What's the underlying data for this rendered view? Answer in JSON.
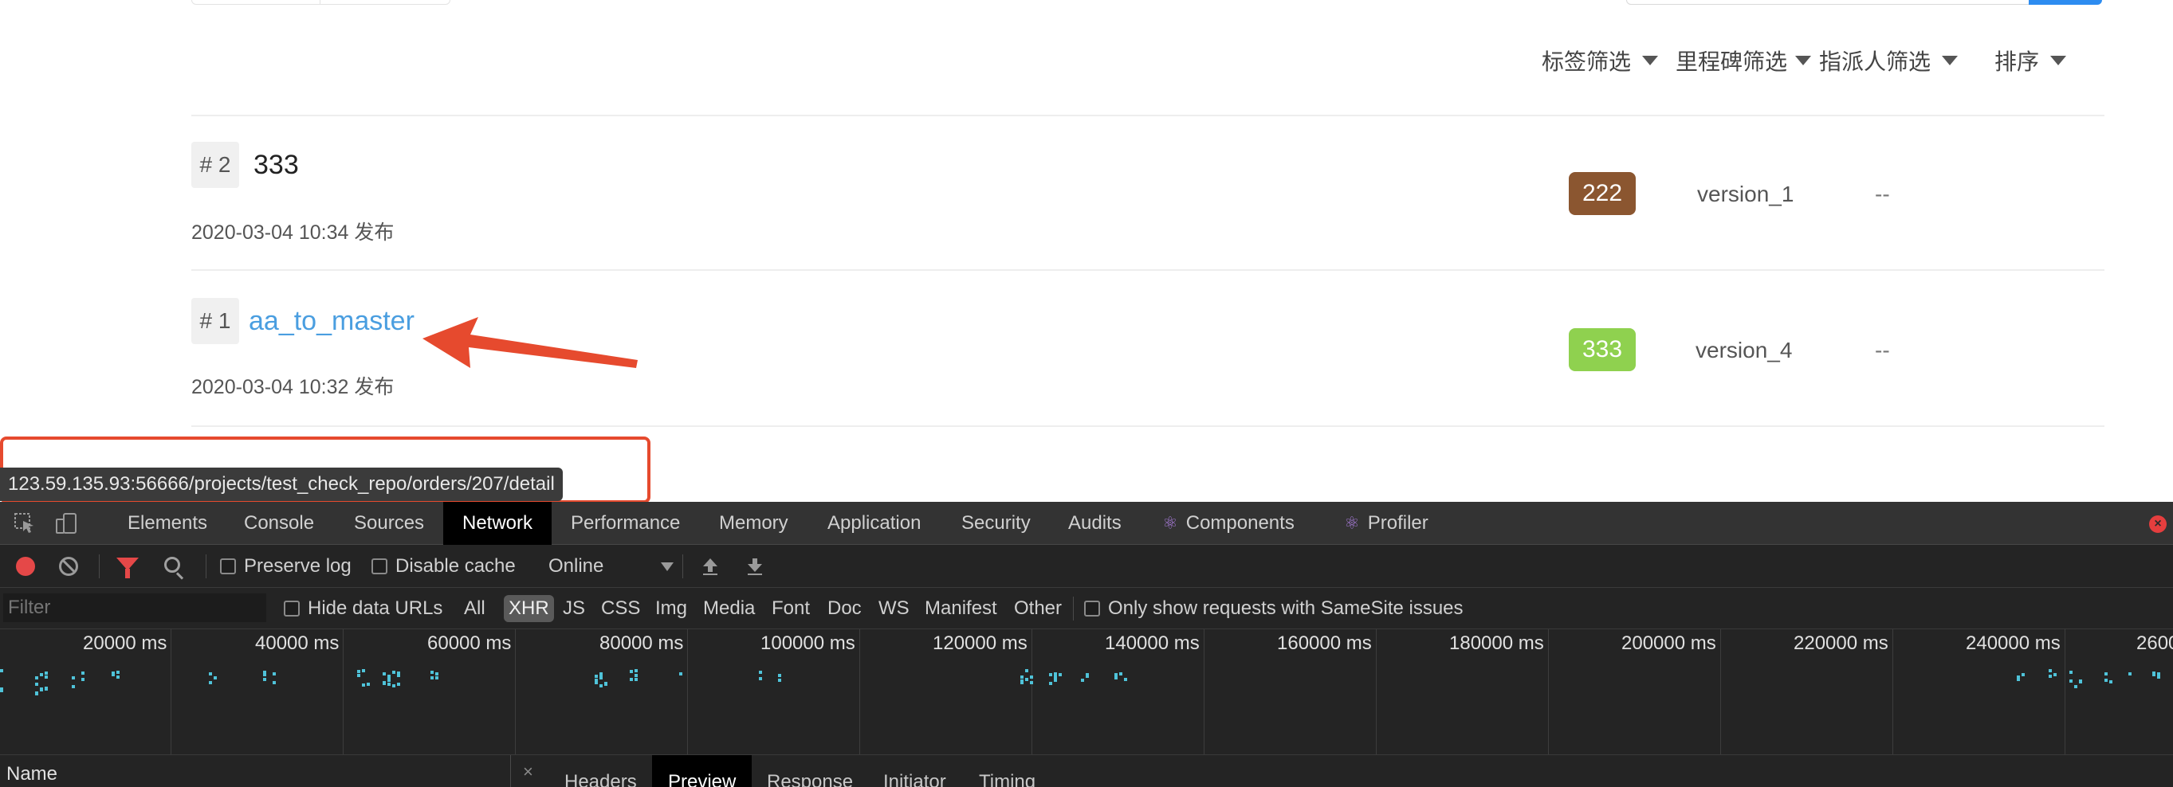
{
  "filters": {
    "label_filter": "标签筛选",
    "milestone_filter": "里程碑筛选",
    "assignee_filter": "指派人筛选",
    "sort": "排序"
  },
  "orders": [
    {
      "number": "# 2",
      "title": "333",
      "date": "2020-03-04 10:34 发布",
      "tag": "222",
      "tag_color": "#8b5630",
      "milestone": "version_1",
      "assignee": "--"
    },
    {
      "number": "# 1",
      "title": "aa_to_master",
      "date": "2020-03-04 10:32 发布",
      "tag": "333",
      "tag_color": "#8fd14f",
      "milestone": "version_4",
      "assignee": "--"
    }
  ],
  "status_url": "123.59.135.93:56666/projects/test_check_repo/orders/207/detail",
  "annotation": {
    "arrow_color": "#e64a2e",
    "highlight_color": "#e64a2e"
  },
  "devtools": {
    "tabs": [
      {
        "label": "Elements",
        "active": false
      },
      {
        "label": "Console",
        "active": false
      },
      {
        "label": "Sources",
        "active": false
      },
      {
        "label": "Network",
        "active": true
      },
      {
        "label": "Performance",
        "active": false
      },
      {
        "label": "Memory",
        "active": false
      },
      {
        "label": "Application",
        "active": false
      },
      {
        "label": "Security",
        "active": false
      },
      {
        "label": "Audits",
        "active": false
      },
      {
        "label": "Components",
        "active": false,
        "icon": "react-icon"
      },
      {
        "label": "Profiler",
        "active": false,
        "icon": "react-icon"
      }
    ],
    "toolbar": {
      "preserve_log": "Preserve log",
      "disable_cache": "Disable cache",
      "throttle": "Online"
    },
    "filterbar": {
      "filter_placeholder": "Filter",
      "hide_data_urls": "Hide data URLs",
      "types": [
        "All",
        "XHR",
        "JS",
        "CSS",
        "Img",
        "Media",
        "Font",
        "Doc",
        "WS",
        "Manifest",
        "Other"
      ],
      "active_type": "XHR",
      "samesite": "Only show requests with SameSite issues"
    },
    "timeline_labels": [
      "20000 ms",
      "40000 ms",
      "60000 ms",
      "80000 ms",
      "100000 ms",
      "120000 ms",
      "140000 ms",
      "160000 ms",
      "180000 ms",
      "200000 ms",
      "220000 ms",
      "240000 ms",
      "2600"
    ],
    "bottom": {
      "name_column": "Name",
      "close_glyph": "×",
      "panel_tabs": [
        {
          "label": "Headers",
          "active": false
        },
        {
          "label": "Preview",
          "active": true
        },
        {
          "label": "Response",
          "active": false
        },
        {
          "label": "Initiator",
          "active": false
        },
        {
          "label": "Timing",
          "active": false
        }
      ]
    }
  }
}
